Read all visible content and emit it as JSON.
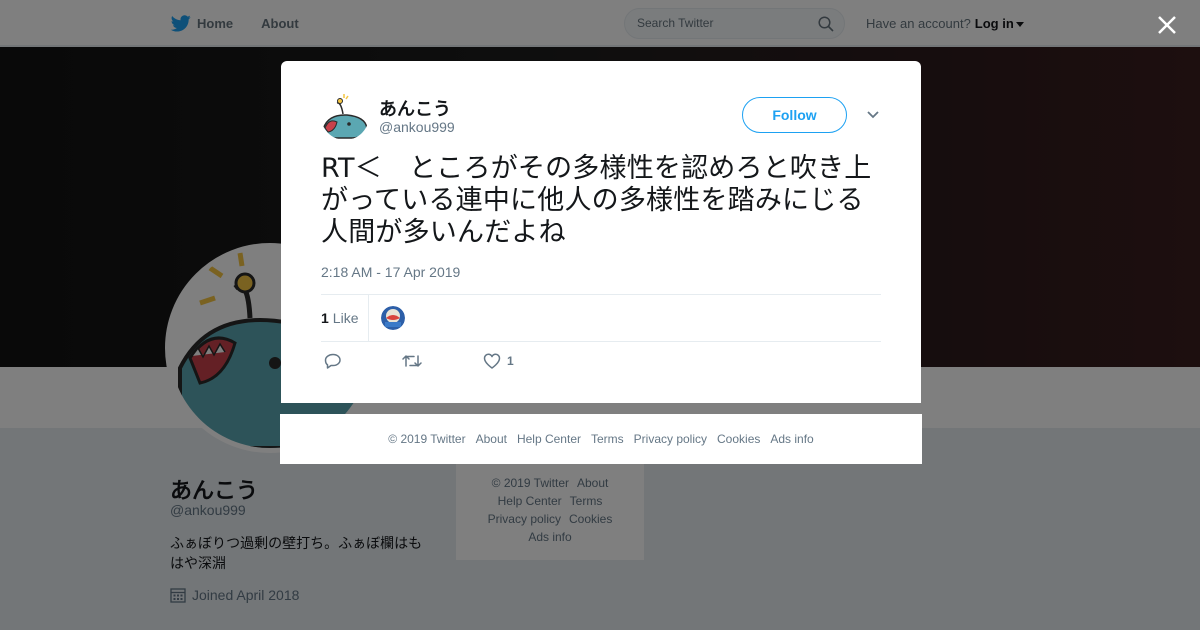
{
  "topbar": {
    "home_label": "Home",
    "about_label": "About",
    "search_placeholder": "Search Twitter",
    "account_prompt": "Have an account?",
    "login_label": "Log in"
  },
  "profile": {
    "name": "あんこう",
    "handle": "@ankou999",
    "bio": "ふぁぼりつ過剰の壁打ち。ふぁぼ欄はもはや深淵",
    "joined": "Joined April 2018"
  },
  "side_footer": {
    "copyright": "© 2019 Twitter",
    "about": "About",
    "help": "Help Center",
    "terms": "Terms",
    "privacy": "Privacy policy",
    "cookies": "Cookies",
    "ads": "Ads info"
  },
  "tweet": {
    "author_name": "あんこう",
    "author_handle": "@ankou999",
    "follow_label": "Follow",
    "text": "RT＜　ところがその多様性を認めろと吹き上がっている連中に他人の多様性を踏みにじる人間が多いんだよね",
    "timestamp": "2:18 AM - 17 Apr 2019",
    "like_count": "1",
    "like_label": "Like",
    "action_like_count": "1"
  },
  "modal_footer": {
    "copyright": "© 2019 Twitter",
    "about": "About",
    "help": "Help Center",
    "terms": "Terms",
    "privacy": "Privacy policy",
    "cookies": "Cookies",
    "ads": "Ads info"
  },
  "colors": {
    "accent": "#1da1f2",
    "muted": "#657786",
    "fish_body": "#5ba7b2"
  },
  "icons": [
    "twitter-bird-icon",
    "search-icon",
    "close-icon",
    "chevron-down-icon",
    "reply-icon",
    "retweet-icon",
    "heart-icon",
    "calendar-icon"
  ]
}
